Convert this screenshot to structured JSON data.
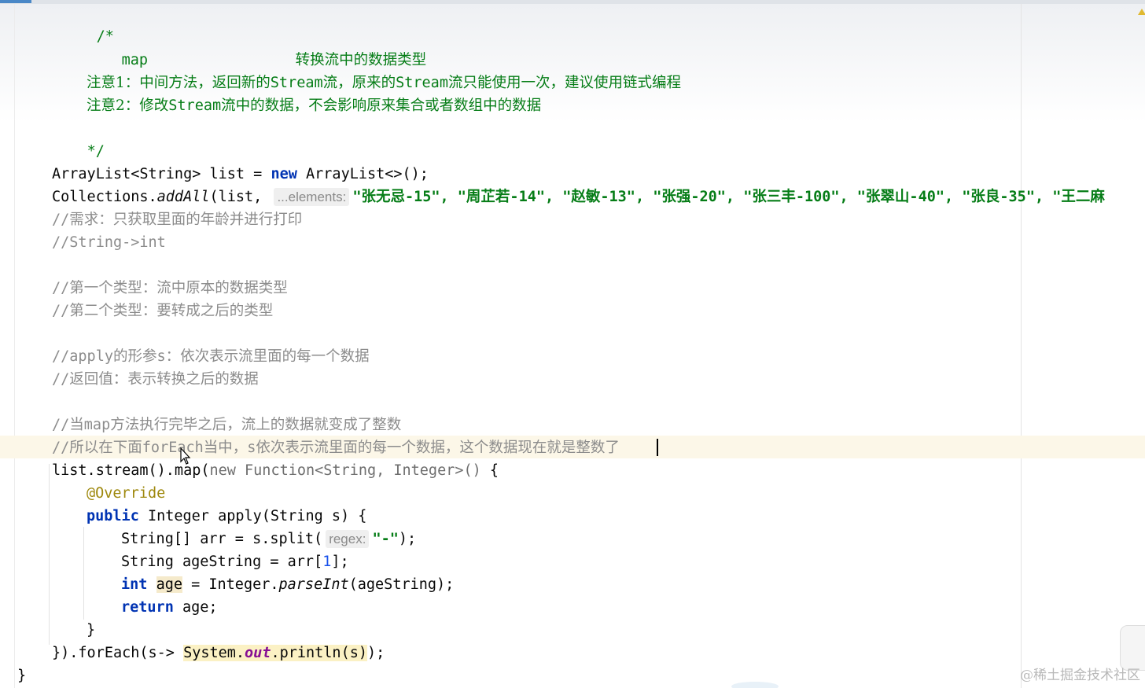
{
  "editor": {
    "lines": {
      "l1_open": "/*",
      "l2_map_kw": "map",
      "l2_map_desc": "转换流中的数据类型",
      "l4_a": "注意1：中间方法，返回新的",
      "l4_b": "Stream",
      "l4_c": "流，原来的",
      "l4_d": "Stream",
      "l4_e": "流只能使用一次，建议使用链式编程",
      "l5_a": "注意2：修改",
      "l5_b": "Stream",
      "l5_c": "流中的数据，不会影响原来集合或者数组中的数据",
      "l6_close": "*/",
      "l8_a": "ArrayList<String> list = ",
      "l8_kw": "new",
      "l8_b": " ArrayList<>();",
      "l9_a": "Collections.",
      "l9_method": "addAll",
      "l9_b": "(list, ",
      "l9_hint": "...elements:",
      "l9_strings": "\"张无忌-15\", \"周芷若-14\", \"赵敏-13\", \"张强-20\", \"张三丰-100\", \"张翠山-40\", \"张良-35\", \"王二麻",
      "l10_a": "//",
      "l10_b": "需求：只获取里面的年龄并进行打印",
      "l11": "//String->int",
      "l13_a": "//",
      "l13_b": "第一个类型：流中原本的数据类型",
      "l14_a": "//",
      "l14_b": "第二个类型：要转成之后的类型",
      "l16_a": "//apply",
      "l16_b": "的形参",
      "l16_c": "s",
      "l16_d": "：依次表示流里面的每一个数据",
      "l17_a": "//",
      "l17_b": "返回值：表示转换之后的数据",
      "l19_a": "//",
      "l19_b": "当",
      "l19_c": "map",
      "l19_d": "方法执行完毕之后，流上的数据就变成了整数",
      "l20_a": "//",
      "l20_b": "所以在下面",
      "l20_c": "forEach",
      "l20_d": "当中，",
      "l20_e": "s",
      "l20_f": "依次表示流里面的每一个数据，这个数据现在就是整数了",
      "l21_a": "list.stream().map(",
      "l21_dim": "new Function<String, Integer>()",
      "l21_b": " {",
      "l22": "@Override",
      "l23_kw": "public",
      "l23_b": " Integer apply(String s) {",
      "l24_a": "String[] arr = s.split(",
      "l24_hint": "regex:",
      "l24_str": "\"-\"",
      "l24_b": ");",
      "l25_a": "String ageString = arr[",
      "l25_num": "1",
      "l25_b": "];",
      "l26_kw": "int",
      "l26_var": "age",
      "l26_a": " = Integer.",
      "l26_method": "parseInt",
      "l26_b": "(ageString);",
      "l27_kw": "return",
      "l27_b": " age;",
      "l28": "}",
      "l29_a": "}).forEach(s-> ",
      "l29_sys": "System.",
      "l29_out": "out",
      "l29_b": ".println(s)",
      "l29_c": ");",
      "l30": "}"
    }
  },
  "watermark": "@稀土掘金技术社区",
  "colors": {
    "keyword": "#0033b3",
    "string": "#067d17",
    "comment": "#8c8c8c",
    "number": "#1750eb",
    "annotation": "#9e880d"
  }
}
